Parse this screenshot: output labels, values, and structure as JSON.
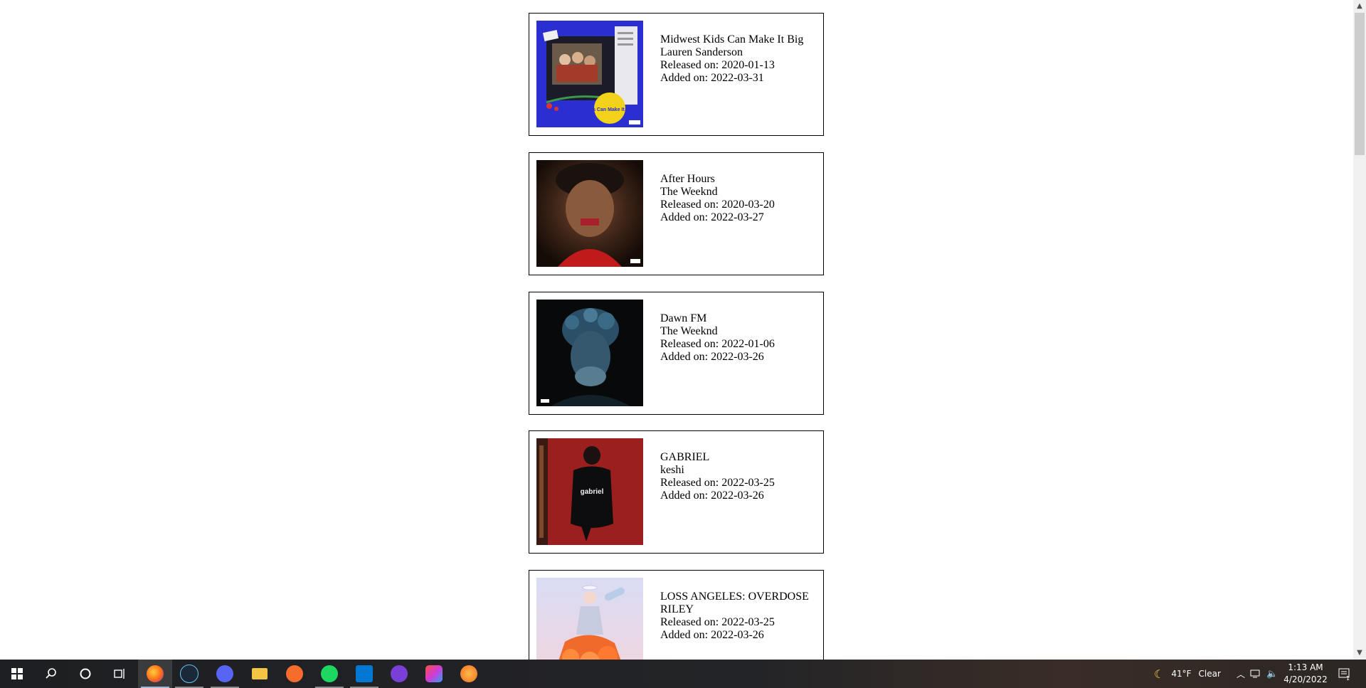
{
  "albums": [
    {
      "title": "Midwest Kids Can Make It Big",
      "artist": "Lauren Sanderson",
      "released_prefix": "Released on: ",
      "released": "2020-01-13",
      "added_prefix": "Added on: ",
      "added": "2022-03-31"
    },
    {
      "title": "After Hours",
      "artist": "The Weeknd",
      "released_prefix": "Released on: ",
      "released": "2020-03-20",
      "added_prefix": "Added on: ",
      "added": "2022-03-27"
    },
    {
      "title": "Dawn FM",
      "artist": "The Weeknd",
      "released_prefix": "Released on: ",
      "released": "2022-01-06",
      "added_prefix": "Added on: ",
      "added": "2022-03-26"
    },
    {
      "title": "GABRIEL",
      "artist": "keshi",
      "released_prefix": "Released on: ",
      "released": "2022-03-25",
      "added_prefix": "Added on: ",
      "added": "2022-03-26"
    },
    {
      "title": "LOSS ANGELES: OVERDOSE",
      "artist": "RILEY",
      "released_prefix": "Released on: ",
      "released": "2022-03-25",
      "added_prefix": "Added on: ",
      "added": "2022-03-26"
    }
  ],
  "cover_texts": {
    "midwest": "Kids Can Make It BIG",
    "gabriel": "gabriel"
  },
  "taskbar": {
    "apps": [
      "start-icon",
      "search-icon",
      "cortana-icon",
      "task-view-icon",
      "firefox-icon",
      "steam-icon",
      "discord-icon",
      "file-explorer-icon",
      "origin-icon",
      "spotify-icon",
      "vscode-icon",
      "github-desktop-icon",
      "creative-cloud-icon",
      "fl-studio-icon"
    ],
    "weather_temp": "41°F",
    "weather_desc": "Clear",
    "time": "1:13 AM",
    "date": "4/20/2022",
    "notification_count": "1"
  },
  "colors": {
    "taskbar_bg": "#1e1f22",
    "active_underline": "#9db7d8"
  }
}
